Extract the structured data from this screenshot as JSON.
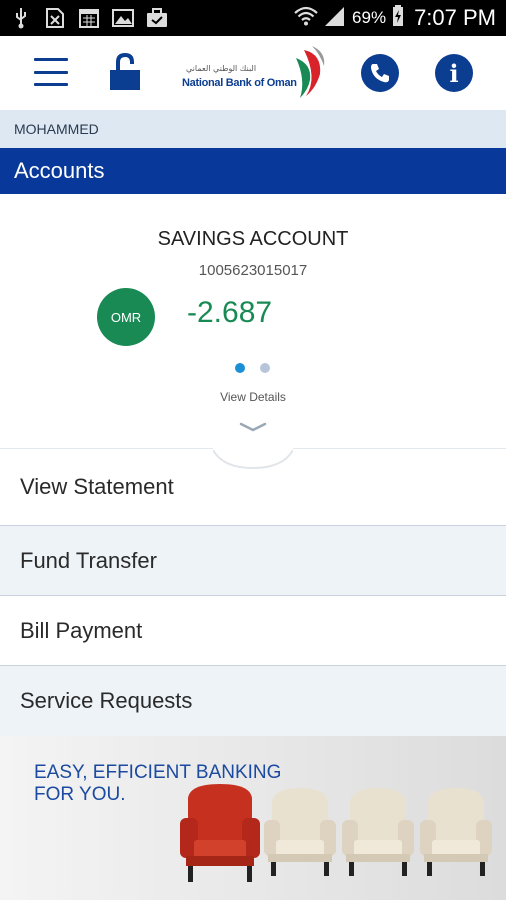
{
  "status_bar": {
    "battery": "69%",
    "time": "7:07 PM",
    "icons": [
      "usb-icon",
      "sim-icon",
      "calendar-icon",
      "image-icon",
      "briefcase-icon",
      "wifi-icon",
      "signal-icon",
      "battery-icon"
    ]
  },
  "header": {
    "logo_arabic": "البنك الوطني العماني",
    "logo_english": "National Bank of Oman",
    "icons": [
      "menu-icon",
      "unlock-icon",
      "phone-icon",
      "info-icon"
    ],
    "accent_color": "#08399a"
  },
  "user": {
    "name": "MOHAMMED"
  },
  "section_title": "Accounts",
  "account": {
    "type": "SAVINGS ACCOUNT",
    "number": "1005623015017",
    "currency": "OMR",
    "balance": "-2.687",
    "balance_color": "#1a8a55",
    "page_count": 2,
    "active_page": 1,
    "view_details": "View Details"
  },
  "menu": [
    {
      "label": "View Statement"
    },
    {
      "label": "Fund Transfer"
    },
    {
      "label": "Bill Payment"
    },
    {
      "label": "Service Requests"
    }
  ],
  "banner": {
    "line1": "EASY, EFFICIENT BANKING",
    "line2": "FOR YOU."
  }
}
